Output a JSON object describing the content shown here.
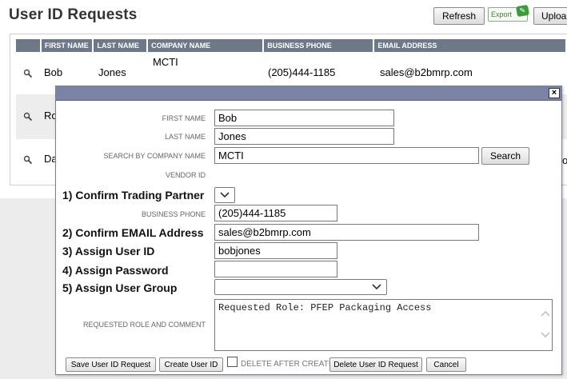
{
  "page": {
    "title": "User ID Requests",
    "refresh_label": "Refresh",
    "export_label": "Export",
    "upload_label": "Uploa"
  },
  "grid": {
    "columns": [
      "FIRST NAME",
      "LAST NAME",
      "COMPANY NAME",
      "BUSINESS PHONE",
      "EMAIL ADDRESS"
    ],
    "rows": [
      {
        "first": "Bob",
        "last": "Jones",
        "company": "MCTI",
        "phone": "(205)444-1185",
        "email": "sales@b2bmrp.com"
      },
      {
        "first": "Ro"
      },
      {
        "first": "Da",
        "trailing": "o"
      }
    ]
  },
  "dialog": {
    "close_label": "×",
    "labels": {
      "first_name": "FIRST NAME",
      "last_name": "LAST NAME",
      "search_company": "SEARCH BY COMPANY NAME",
      "vendor_id": "VENDOR ID",
      "confirm_partner": "1) Confirm Trading Partner",
      "business_phone": "BUSINESS PHONE",
      "confirm_email": "2) Confirm EMAIL Address",
      "assign_user_id": "3) Assign User ID",
      "assign_password": "4) Assign Password",
      "assign_group": "5) Assign User Group",
      "role_comment": "REQUESTED ROLE AND COMMENT"
    },
    "values": {
      "first_name": "Bob",
      "last_name": "Jones",
      "company": "MCTI",
      "business_phone": "(205)444-1185",
      "email": "sales@b2bmrp.com",
      "user_id": "bobjones",
      "password": "",
      "role_comment": "Requested Role: PFEP Packaging Access"
    },
    "search_button": "Search",
    "buttons": {
      "save": "Save User ID Request",
      "create": "Create User ID",
      "delete_after_create": "DELETE AFTER CREATE",
      "delete": "Delete User ID Request",
      "cancel": "Cancel"
    }
  },
  "icons": {
    "magnifier": "search-icon",
    "chevron": "chevron-down-icon",
    "close": "close-icon"
  }
}
